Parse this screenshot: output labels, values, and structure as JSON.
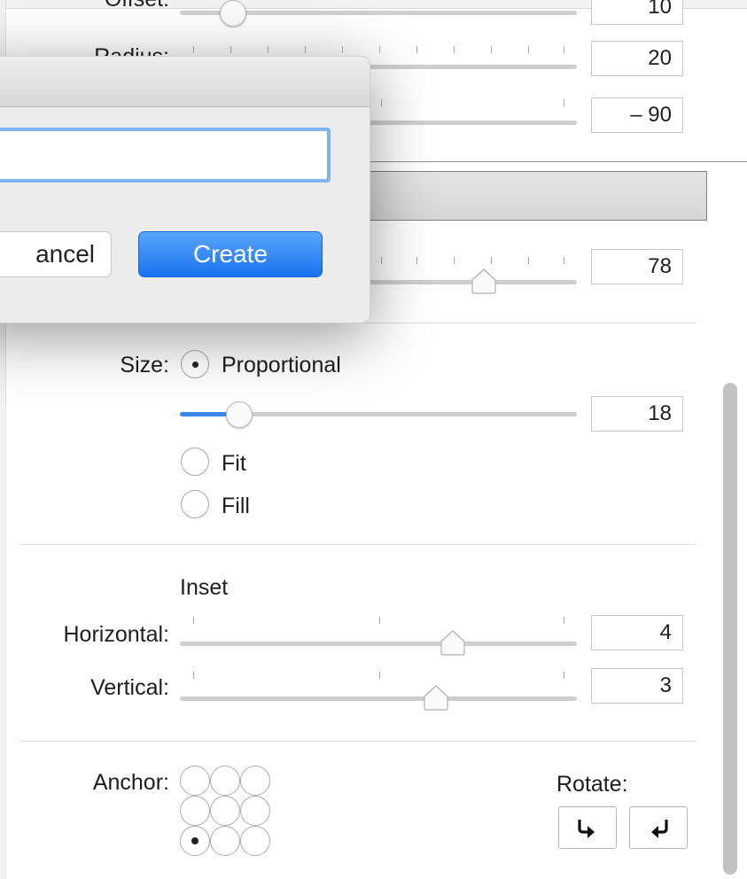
{
  "shadow": {
    "offset_label": "Offset:",
    "offset_value": "10",
    "radius_label": "Radius:",
    "radius_value": "20",
    "angle_value": "– 90"
  },
  "opacity": {
    "value": "78"
  },
  "size": {
    "label": "Size:",
    "options": [
      "Proportional",
      "Fit",
      "Fill"
    ],
    "selected": "Proportional",
    "proportional_value": "18"
  },
  "inset": {
    "heading": "Inset",
    "horizontal_label": "Horizontal:",
    "horizontal_value": "4",
    "vertical_label": "Vertical:",
    "vertical_value": "3"
  },
  "anchor": {
    "label": "Anchor:",
    "selected": "bottom-left"
  },
  "rotate": {
    "label": "Rotate:",
    "clockwise_icon": "rotate-clockwise-icon",
    "counterclockwise_icon": "rotate-counterclockwise-icon"
  },
  "dialog": {
    "name_value": "",
    "cancel_label": "ancel",
    "create_label": "Create"
  },
  "colors": {
    "accent": "#3b87f0",
    "create_button": "#1f7af0",
    "focus_ring": "#7fb2ef"
  }
}
